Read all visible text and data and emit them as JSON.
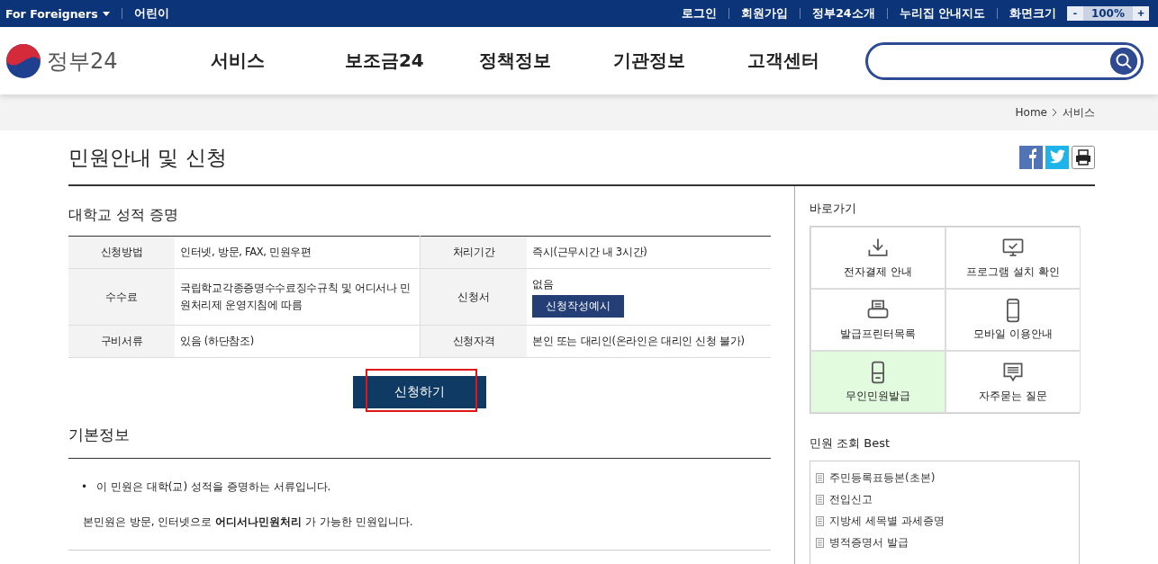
{
  "top_bar": {
    "left": [
      {
        "label": "For Foreigners",
        "dropdown": true
      },
      {
        "label": "어린이",
        "dropdown": false
      }
    ],
    "right": [
      "로그인",
      "회원가입",
      "정부24소개",
      "누리집 안내지도"
    ],
    "zoom": {
      "label": "화면크기",
      "minus": "-",
      "value": "100%",
      "plus": "+"
    }
  },
  "header": {
    "logo": "정부24",
    "nav": [
      "서비스",
      "보조금24",
      "정책정보",
      "기관정보",
      "고객센터"
    ],
    "search": {
      "kind": "rounded"
    }
  },
  "breadcrumb": [
    "Home",
    "서비스"
  ],
  "page_title": "민원안내 및 신청",
  "section_title": "대학교 성적 증명",
  "info_table": [
    {
      "label_1": "신청방법",
      "value_1": "인터넷, 방문, FAX, 민원우편",
      "label_2": "처리기간",
      "value_2": "즉시(근무시간 내 3시간)"
    },
    {
      "label_1": "수수료",
      "value_1": "국립학교각종증명수수료징수규칙 및 어디서나 민원처리제 운영지침에 따름",
      "label_2": "신청서",
      "value_2": "없음",
      "button": "신청작성예시"
    },
    {
      "label_1": "구비서류",
      "value_1": "있음 (하단참조)",
      "label_2": "신청자격",
      "value_2": "본인 또는 대리인(온라인은 대리인 신청 불가)"
    }
  ],
  "apply_button": {
    "label": "신청하기",
    "highlighted": true
  },
  "basic_info": {
    "title": "기본정보",
    "bullets": [
      {
        "marker": "•",
        "text": "이 민원은 대학(교) 성적을 증명하는 서류입니다."
      }
    ],
    "paragraph": "본민원은 방문, 인터넷으로 **어디서나민원처리** 가 가능한 민원입니다."
  },
  "quick_links": {
    "title": "바로가기",
    "items": [
      {
        "kind": "download",
        "label": "전자결제 안내",
        "highlighted": false
      },
      {
        "kind": "monitor",
        "label": "프로그램 설치 확인",
        "highlighted": false
      },
      {
        "kind": "printer",
        "label": "발급프린터목록",
        "highlighted": false
      },
      {
        "kind": "phone",
        "label": "모바일 이용안내",
        "highlighted": false
      },
      {
        "kind": "kiosk",
        "label": "무인민원발급",
        "highlighted": true
      },
      {
        "kind": "chat",
        "label": "자주묻는 질문",
        "highlighted": false
      }
    ]
  },
  "best": {
    "title": "민원 조회 Best",
    "items": [
      "주민등록표등본(초본)",
      "전입신고",
      "지방세 세목별 과세증명",
      "병적증명서 발급"
    ]
  }
}
